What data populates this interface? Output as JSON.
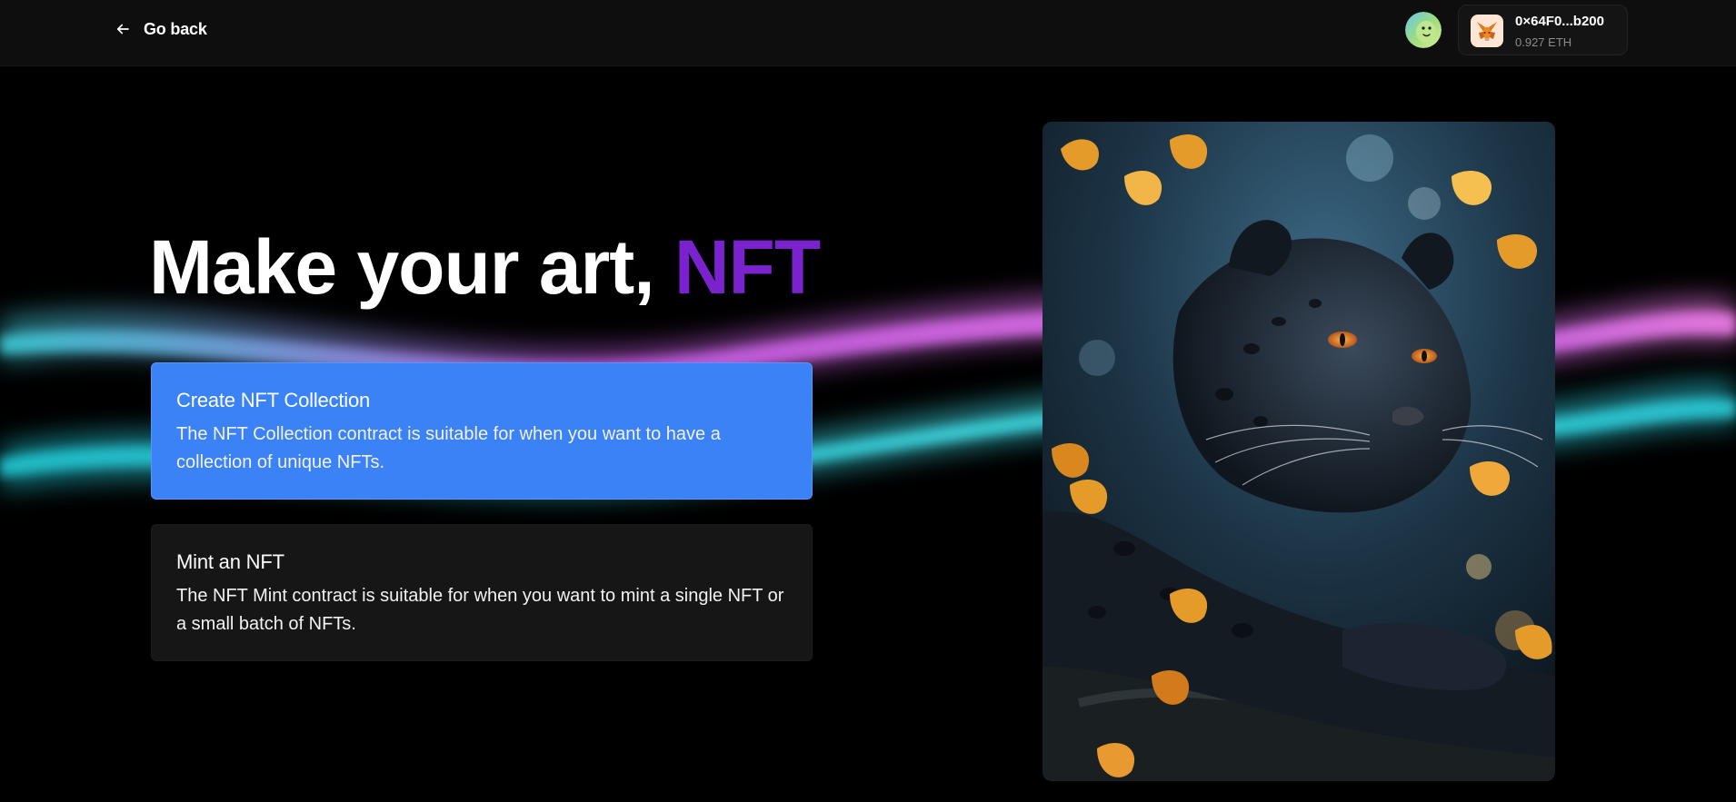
{
  "header": {
    "back_label": "Go back",
    "wallet": {
      "address": "0×64F0...b200",
      "balance": "0.927 ETH"
    }
  },
  "hero": {
    "title_main": "Make your art, ",
    "title_accent": "NFT",
    "accent_color": "#7b22cf"
  },
  "options": [
    {
      "title": "Create NFT Collection",
      "description": "The NFT Collection contract is suitable for when you want to have a collection of unique NFTs.",
      "selected": true,
      "color": "#3b82f6"
    },
    {
      "title": "Mint an NFT",
      "description": "The NFT Mint contract is suitable for when you want to mint a single NFT or a small batch of NFTs.",
      "selected": false,
      "color": "#161616"
    }
  ],
  "artwork": {
    "subject": "black panther among autumn leaves"
  },
  "icons": {
    "back": "arrow-left-icon",
    "wallet": "metamask-fox-icon",
    "avatar": "user-avatar"
  }
}
